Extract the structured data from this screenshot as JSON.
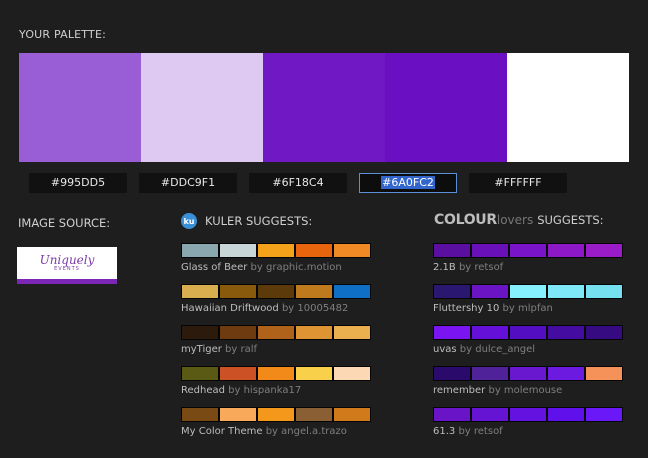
{
  "palette_title": "YOUR PALETTE:",
  "palette": [
    {
      "color": "#995DD5",
      "label": "#995DD5"
    },
    {
      "color": "#DDC9F1",
      "label": "#DDC9F1"
    },
    {
      "color": "#6F18C4",
      "label": "#6F18C4"
    },
    {
      "color": "#6A0FC2",
      "label": "#6A0FC2",
      "selected": true
    },
    {
      "color": "#FFFFFF",
      "label": "#FFFFFF"
    }
  ],
  "image_source": {
    "label": "IMAGE SOURCE:",
    "logo_text": "Uniquely",
    "logo_sub": "EVENTS"
  },
  "kuler": {
    "icon_text": "ku",
    "label": "KULER SUGGESTS:",
    "items": [
      {
        "name": "Glass of Beer",
        "by": " by graphic.motion",
        "colors": [
          "#8aa7b0",
          "#c8d6d8",
          "#f4a21a",
          "#e8650e",
          "#f08a24"
        ]
      },
      {
        "name": "Hawaiian Driftwood",
        "by": " by 10005482",
        "colors": [
          "#d8ae4e",
          "#8a5a0c",
          "#5c3a0a",
          "#c07a1e",
          "#0f6fc4"
        ]
      },
      {
        "name": "myTiger",
        "by": " by ralf",
        "colors": [
          "#2c1a0c",
          "#6e3a10",
          "#b0621a",
          "#de9432",
          "#eab050"
        ]
      },
      {
        "name": "Redhead",
        "by": " by hispanka17",
        "colors": [
          "#5a5a14",
          "#cc5226",
          "#f28a1a",
          "#f8d04a",
          "#fcd8b4"
        ]
      },
      {
        "name": "My Color Theme",
        "by": " by angel.a.trazo",
        "colors": [
          "#7a4a14",
          "#f8aa5a",
          "#f4981c",
          "#8a5f34",
          "#d07a1c"
        ]
      }
    ]
  },
  "colourlovers": {
    "colour": "COLOUR",
    "lovers": "lovers",
    "label": "SUGGESTS:",
    "items": [
      {
        "name": "2.1B",
        "by": " by retsof",
        "colors": [
          "#5a0fa0",
          "#6a10b8",
          "#7a14c8",
          "#8c18c8",
          "#9a1cc8"
        ]
      },
      {
        "name": "Fluttershy 10",
        "by": " by mlpfan",
        "colors": [
          "#2a1870",
          "#6a14c4",
          "#86f0ff",
          "#7ee8f8",
          "#74e0f0"
        ]
      },
      {
        "name": "uvas",
        "by": " by dulce_angel",
        "colors": [
          "#7a14f0",
          "#6410d8",
          "#520ec0",
          "#440ca0",
          "#360a80"
        ]
      },
      {
        "name": "remember",
        "by": " by molemouse",
        "colors": [
          "#2a0a6a",
          "#50229a",
          "#6a18d0",
          "#6c1ae0",
          "#f4925a"
        ]
      },
      {
        "name": "61.3",
        "by": " by retsof",
        "colors": [
          "#6a14c8",
          "#6614d4",
          "#6412e0",
          "#6010ea",
          "#6a18f8"
        ]
      }
    ]
  }
}
